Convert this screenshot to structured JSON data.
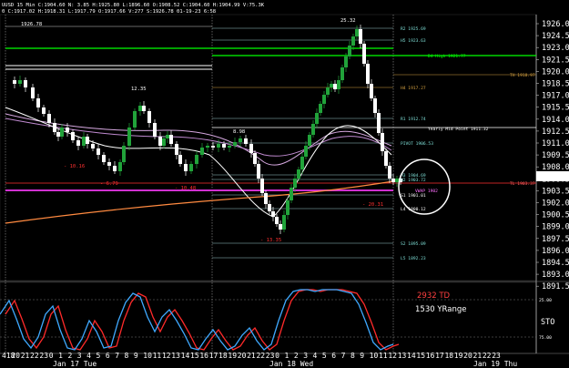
{
  "header": {
    "title": "UUSD 15 Min",
    "ohlc_line1": "C:1904.60  N: 3.85  H:1925.80  L:1896.60  O:1908.52  C:1904.60  H:1904.99  V:75.3K",
    "ohlc_line2": "0  C:1917.02  H:1918.31  L:1917.79  O:1917.66  V:277  S:1926.78  01-19-23  6:58"
  },
  "price_axis": {
    "ticks": [
      "1926.00",
      "1924.50",
      "1923.00",
      "1921.50",
      "1920.00",
      "1918.50",
      "1917.00",
      "1915.50",
      "1914.00",
      "1912.50",
      "1911.00",
      "1909.50",
      "1908.00",
      "1906.50",
      "1903.50",
      "1902.00",
      "1900.50",
      "1899.00",
      "1897.50",
      "1896.00",
      "1894.50",
      "1893.00",
      "1891.50"
    ],
    "current_price": "1904.60"
  },
  "annotations": {
    "peak": "25.32",
    "prev_high": "1926.78",
    "high1": "12.35",
    "high2": "8.98",
    "low1": "- 10.16",
    "low2": "- 6.79",
    "low3": "- 10.48",
    "low4": "- 13.35",
    "low5": "- 20.31",
    "r2": "R2  1925.69",
    "h5": "H5  1923.63",
    "day_high": "D4 High  1921.77",
    "tr": "TH  1918.97",
    "h4": "H4 1917.27",
    "r1": "R1  1912.74",
    "yearly_mid": "Yearly Mid Point  1911.32",
    "pivot": "PIVOT  1906.53",
    "h3": "H3  1904.69",
    "h2": "H2  1903.72",
    "vwap": "VWAP  1902",
    "s1": "S1  1901.01",
    "tl": "TL  1903.37",
    "l4": "L4  1900.12",
    "s2": "S2  1895.09",
    "l5": "L5  1892.23"
  },
  "oscillator": {
    "td_label": "2932 TD",
    "yrange_label": "1530 YRange",
    "sto_label": "STO",
    "level_high": "25.00",
    "level_low": "75.00"
  },
  "time_axis": {
    "hours": [
      "418",
      "20",
      "21",
      "22",
      "23",
      "0",
      "1",
      "2",
      "3",
      "4",
      "5",
      "6",
      "7",
      "8",
      "9",
      "10",
      "11",
      "12",
      "13",
      "14",
      "15",
      "16",
      "17",
      "18",
      "19",
      "20",
      "21",
      "22",
      "23",
      "0",
      "1",
      "2",
      "3",
      "4",
      "5",
      "6",
      "7",
      "8",
      "9",
      "10",
      "11",
      "12",
      "13",
      "14",
      "15",
      "16",
      "17",
      "18",
      "19",
      "20",
      "21",
      "22",
      "23"
    ],
    "dates": [
      "Jan 17 Tue",
      "Jan 18 Wed",
      "Jan 19 Thu"
    ]
  },
  "colors": {
    "bull": "#21a33a",
    "bear": "#ffffff",
    "ema_short": "#ffffff",
    "ema_mid": "#d6a8e0",
    "ema_long": "#ff8a40",
    "green_line": "#00ff00",
    "pivot_text": "#7fe0d8",
    "magenta": "#d030d0",
    "red": "#ff3030",
    "sto_blue": "#3fa9ff",
    "sto_red": "#ff2a2a"
  }
}
